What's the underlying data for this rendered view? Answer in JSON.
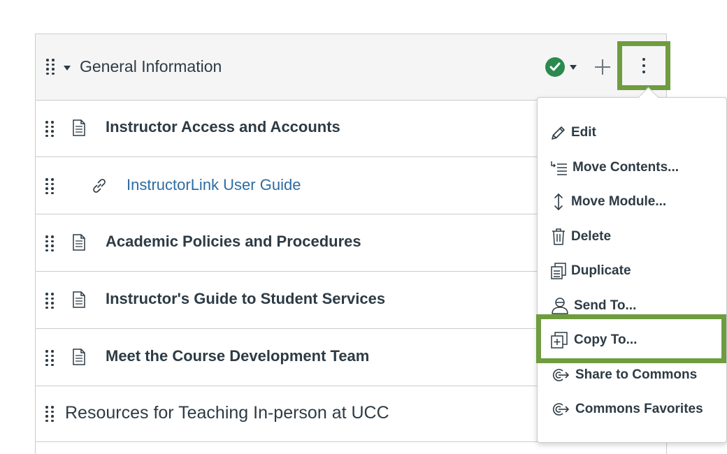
{
  "module": {
    "title": "General Information",
    "items": [
      {
        "type": "page",
        "label": "Instructor Access and Accounts"
      },
      {
        "type": "link",
        "label": "InstructorLink User Guide"
      },
      {
        "type": "page",
        "label": "Academic Policies and Procedures"
      },
      {
        "type": "page",
        "label": "Instructor's Guide to Student Services"
      },
      {
        "type": "page",
        "label": "Meet the Course Development Team"
      }
    ],
    "subheader": "Resources for Teaching In-person at UCC"
  },
  "menu": {
    "items": [
      {
        "label": "Edit",
        "icon": "pencil-icon"
      },
      {
        "label": "Move Contents...",
        "icon": "move-contents-icon"
      },
      {
        "label": "Move Module...",
        "icon": "move-vertical-icon"
      },
      {
        "label": "Delete",
        "icon": "trash-icon"
      },
      {
        "label": "Duplicate",
        "icon": "duplicate-icon"
      },
      {
        "label": "Send To...",
        "icon": "user-icon"
      },
      {
        "label": "Copy To...",
        "icon": "copy-icon"
      },
      {
        "label": "Share to Commons",
        "icon": "commons-share-icon"
      },
      {
        "label": "Commons Favorites",
        "icon": "commons-favorites-icon"
      }
    ]
  },
  "colors": {
    "highlight": "#6e9c3f",
    "published": "#2b8a4e",
    "link": "#2d6ca2",
    "text": "#2d3b45"
  }
}
